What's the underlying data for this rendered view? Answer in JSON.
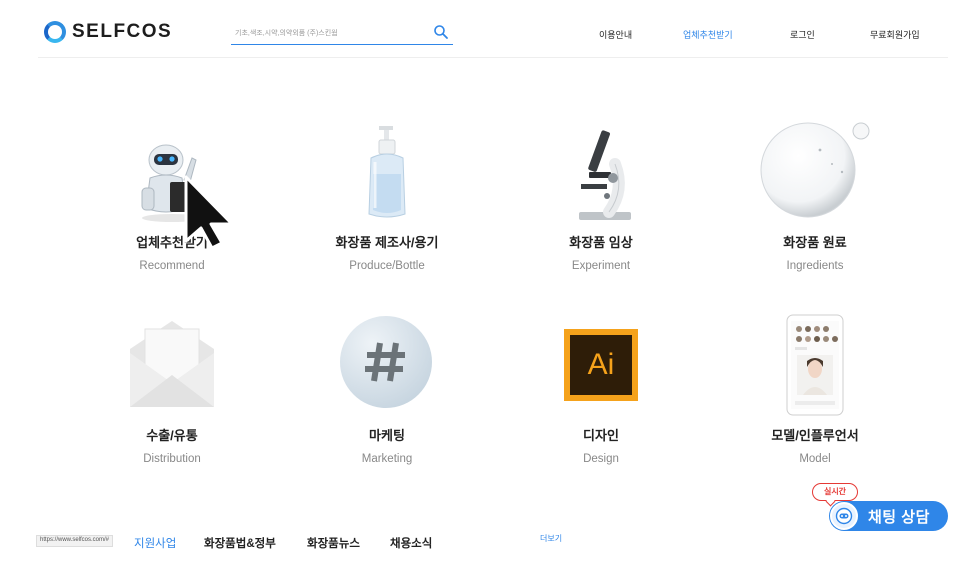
{
  "header": {
    "logo": {
      "text": "SELFCOS",
      "icon": "ring-logo-icon"
    },
    "search": {
      "placeholder": "기초,색조,시약,의약외품 (주)스킨웜",
      "icon": "search-icon"
    },
    "nav": [
      {
        "label": "이용안내",
        "active": false
      },
      {
        "label": "업체추천받기",
        "active": true
      },
      {
        "label": "로그인",
        "active": false
      },
      {
        "label": "무료회원가입",
        "active": false
      }
    ]
  },
  "categories": [
    {
      "title": "업체추천받기",
      "subtitle": "Recommend",
      "icon": "robot-icon"
    },
    {
      "title": "화장품 제조사/용기",
      "subtitle": "Produce/Bottle",
      "icon": "pump-bottle-icon"
    },
    {
      "title": "화장품 임상",
      "subtitle": "Experiment",
      "icon": "microscope-icon"
    },
    {
      "title": "화장품 원료",
      "subtitle": "Ingredients",
      "icon": "bubble-icon"
    },
    {
      "title": "수출/유통",
      "subtitle": "Distribution",
      "icon": "envelope-icon"
    },
    {
      "title": "마케팅",
      "subtitle": "Marketing",
      "icon": "hashtag-icon"
    },
    {
      "title": "디자인",
      "subtitle": "Design",
      "icon": "illustrator-icon",
      "icon_text": "Ai"
    },
    {
      "title": "모델/인플루언서",
      "subtitle": "Model",
      "icon": "phone-profile-icon"
    }
  ],
  "footer": {
    "status_url": "https://www.selfcos.com/#",
    "links": [
      {
        "label": "지원사업",
        "active": true
      },
      {
        "label": "화장품법&정부",
        "active": false
      },
      {
        "label": "화장품뉴스",
        "active": false
      },
      {
        "label": "채용소식",
        "active": false
      }
    ],
    "more_label": "더보기"
  },
  "chat": {
    "badge": "실시간",
    "label": "채팅 상담",
    "icon": "chat-bot-icon"
  },
  "colors": {
    "accent": "#2f86e8",
    "badge_red": "#e53935",
    "text_dark": "#222222",
    "text_muted": "#888888"
  }
}
